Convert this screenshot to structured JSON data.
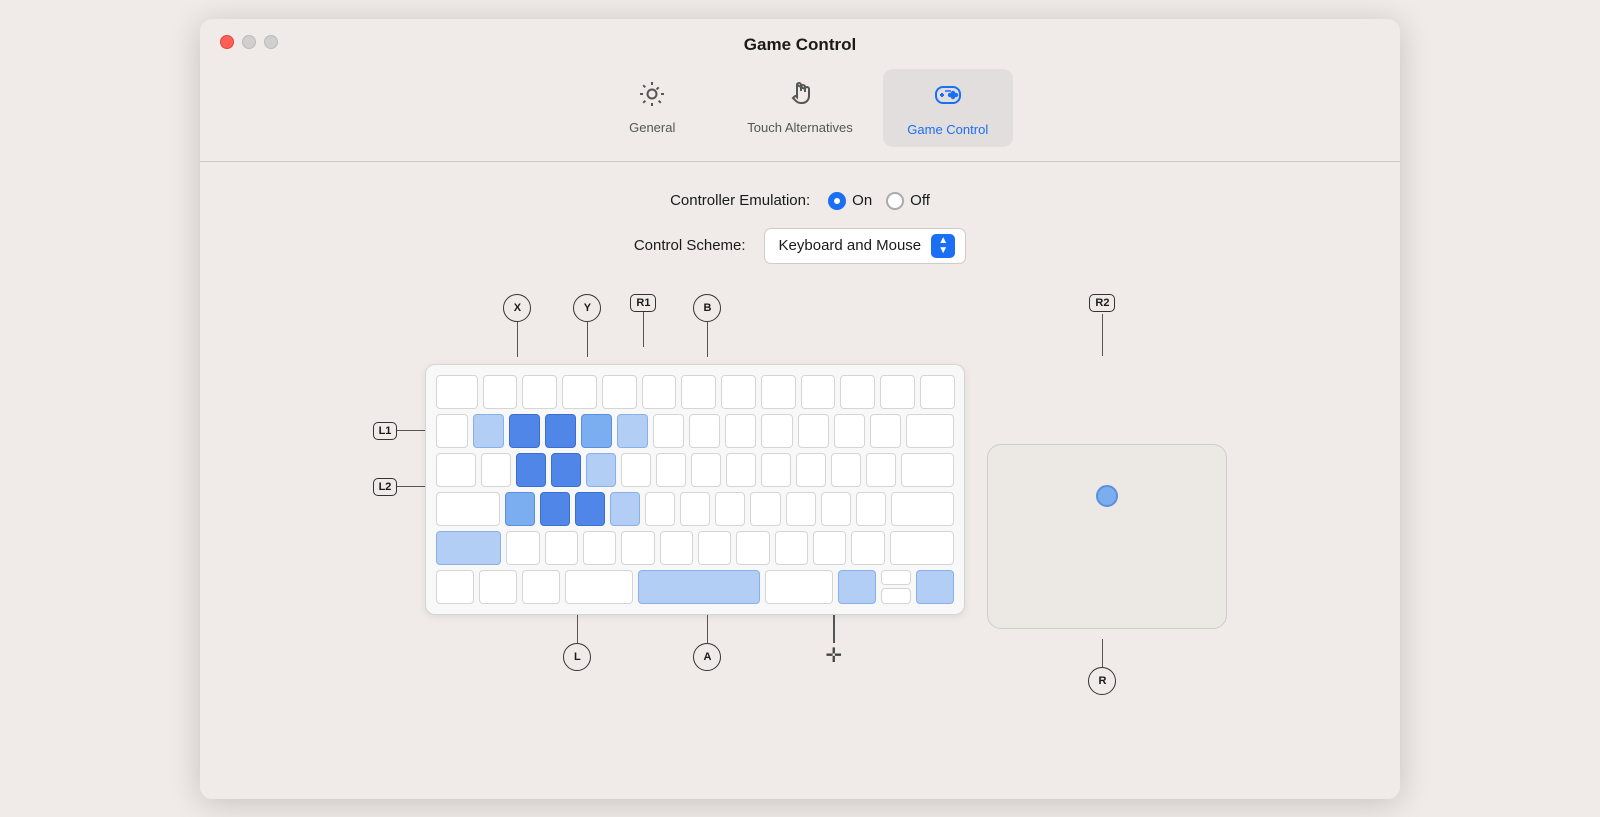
{
  "window": {
    "title": "Game Control"
  },
  "toolbar": {
    "tabs": [
      {
        "id": "general",
        "label": "General",
        "icon": "gear",
        "active": false
      },
      {
        "id": "touch",
        "label": "Touch Alternatives",
        "icon": "hand",
        "active": false
      },
      {
        "id": "gamecontrol",
        "label": "Game Control",
        "icon": "gamepad",
        "active": true
      }
    ]
  },
  "controller_emulation": {
    "label": "Controller Emulation:",
    "options": [
      "On",
      "Off"
    ],
    "selected": "On"
  },
  "control_scheme": {
    "label": "Control Scheme:",
    "value": "Keyboard and Mouse"
  },
  "diagram": {
    "labels_above": [
      "X",
      "Y",
      "R1",
      "B",
      "R2"
    ],
    "labels_left": [
      "L1",
      "L2"
    ],
    "labels_below_keyboard": [
      "L",
      "A",
      "D-Pad",
      "R"
    ]
  }
}
